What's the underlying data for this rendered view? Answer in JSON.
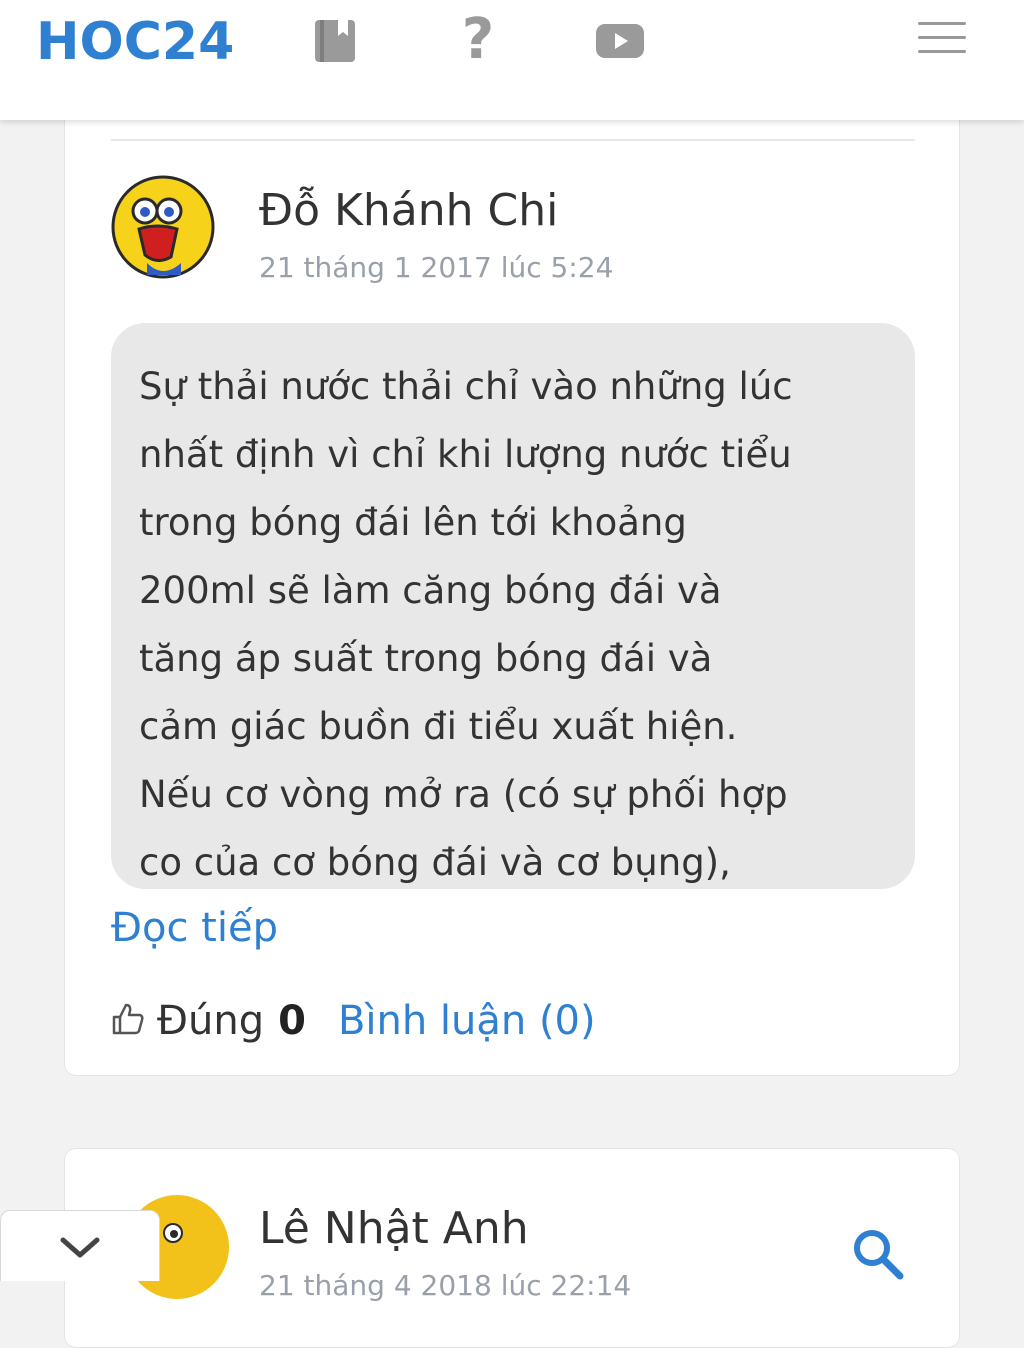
{
  "header": {
    "logo": "HOC24",
    "icons": [
      "book-icon",
      "question-icon",
      "video-play-icon",
      "menu-icon"
    ],
    "accent_color": "#2f80d1"
  },
  "answers": [
    {
      "author": "Đỗ Khánh Chi",
      "date": "21 tháng 1 2017 lúc 5:24",
      "content": "Sự thải nước thải chỉ vào những lúc\nnhất định vì chỉ khi lượng nước tiểu\ntrong bóng đái lên tới khoảng\n200ml sẽ làm căng bóng đái và\ntăng áp suất trong bóng đái và\ncảm giác buồn đi tiểu xuất hiện.\nNếu cơ vòng mở ra (có sự phối hợp\nco của cơ bóng đái và cơ bụng),",
      "read_more": "Đọc tiếp",
      "like_label": "Đúng",
      "like_count": "0",
      "comment_link": "Bình luận (0)"
    },
    {
      "author": "Lê Nhật Anh",
      "date": "21 tháng 4 2018 lúc 22:14"
    }
  ]
}
